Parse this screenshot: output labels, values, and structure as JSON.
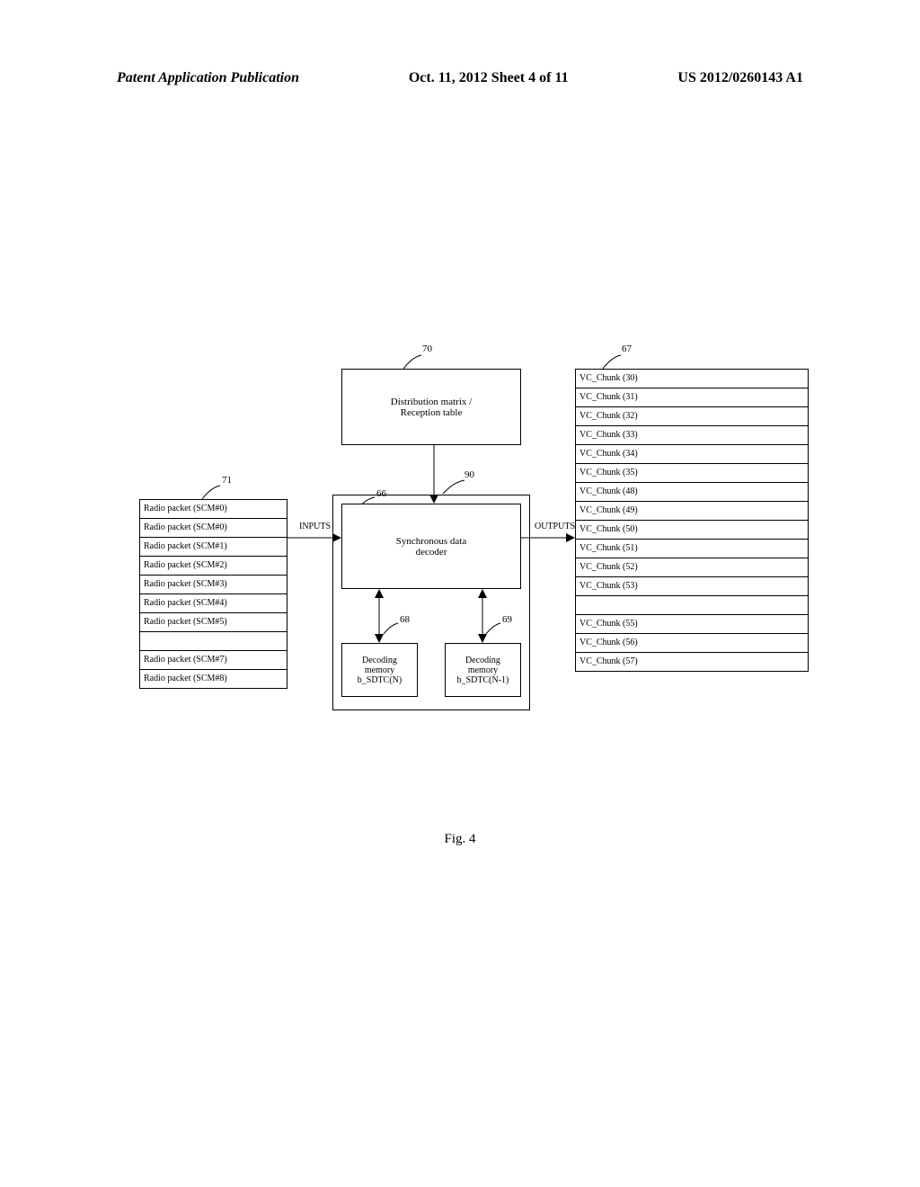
{
  "header": {
    "left": "Patent Application Publication",
    "center": "Oct. 11, 2012  Sheet 4 of 11",
    "right": "US 2012/0260143 A1"
  },
  "fig_label": "Fig. 4",
  "blocks": {
    "dist_matrix": "Distribution matrix /\nReception table",
    "sync_decoder": "Synchronous data\ndecoder",
    "mem_left": "Decoding\nmemory\nb_SDTC(N)",
    "mem_right": "Decoding\nmemory\nb_SDTC(N-1)"
  },
  "io": {
    "inputs": "INPUTS",
    "outputs": "OUTPUTS"
  },
  "refs": {
    "r70": "70",
    "r67": "67",
    "r90": "90",
    "r71": "71",
    "r66": "66",
    "r68": "68",
    "r69": "69"
  },
  "packets": [
    "Radio packet (SCM#0)",
    "Radio packet (SCM#0)",
    "Radio packet (SCM#1)",
    "Radio packet (SCM#2)",
    "Radio packet (SCM#3)",
    "Radio packet (SCM#4)",
    "Radio packet (SCM#5)",
    "",
    "Radio packet (SCM#7)",
    "Radio packet (SCM#8)"
  ],
  "chunks": [
    "VC_Chunk (30)",
    "VC_Chunk (31)",
    "VC_Chunk (32)",
    "VC_Chunk (33)",
    "VC_Chunk (34)",
    "VC_Chunk (35)",
    "VC_Chunk (48)",
    "VC_Chunk (49)",
    "VC_Chunk (50)",
    "VC_Chunk (51)",
    "VC_Chunk (52)",
    "VC_Chunk (53)",
    "",
    "VC_Chunk (55)",
    "VC_Chunk (56)",
    "VC_Chunk (57)"
  ]
}
